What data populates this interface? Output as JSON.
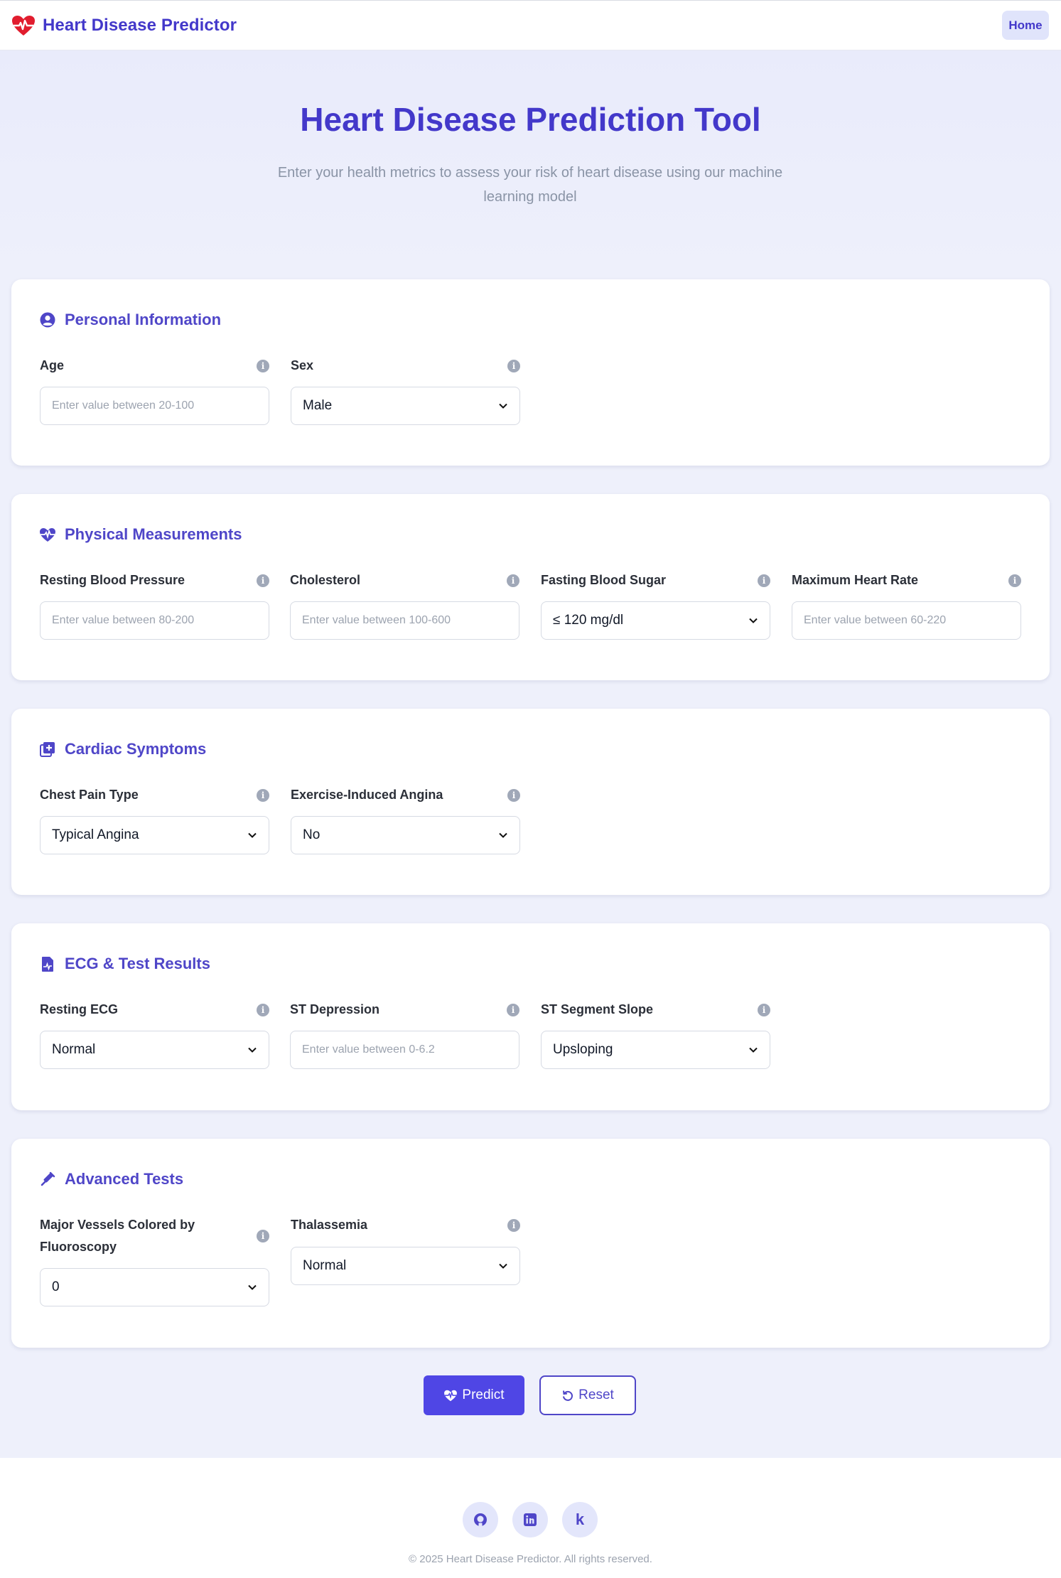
{
  "header": {
    "brand_title": "Heart Disease Predictor",
    "home_label": "Home"
  },
  "hero": {
    "title": "Heart Disease Prediction Tool",
    "subtitle": "Enter your health metrics to assess your risk of heart disease using our machine learning model"
  },
  "sections": {
    "personal": {
      "title": "Personal Information",
      "age": {
        "label": "Age",
        "placeholder": "Enter value between 20-100"
      },
      "sex": {
        "label": "Sex",
        "value": "Male"
      }
    },
    "physical": {
      "title": "Physical Measurements",
      "resting_bp": {
        "label": "Resting Blood Pressure",
        "placeholder": "Enter value between 80-200"
      },
      "cholesterol": {
        "label": "Cholesterol",
        "placeholder": "Enter value between 100-600"
      },
      "fasting_bs": {
        "label": "Fasting Blood Sugar",
        "value": "≤ 120 mg/dl"
      },
      "max_hr": {
        "label": "Maximum Heart Rate",
        "placeholder": "Enter value between 60-220"
      }
    },
    "cardiac": {
      "title": "Cardiac Symptoms",
      "chest_pain": {
        "label": "Chest Pain Type",
        "value": "Typical Angina"
      },
      "exercise_angina": {
        "label": "Exercise-Induced Angina",
        "value": "No"
      }
    },
    "ecg": {
      "title": "ECG & Test Results",
      "resting_ecg": {
        "label": "Resting ECG",
        "value": "Normal"
      },
      "st_depression": {
        "label": "ST Depression",
        "placeholder": "Enter value between 0-6.2"
      },
      "st_slope": {
        "label": "ST Segment Slope",
        "value": "Upsloping"
      }
    },
    "advanced": {
      "title": "Advanced Tests",
      "major_vessels": {
        "label": "Major Vessels Colored by Fluoroscopy",
        "value": "0"
      },
      "thalassemia": {
        "label": "Thalassemia",
        "value": "Normal"
      }
    }
  },
  "actions": {
    "predict_label": "Predict",
    "reset_label": "Reset"
  },
  "footer": {
    "kaggle_letter": "k",
    "copyright": "© 2025 Heart Disease Predictor. All rights reserved."
  },
  "colors": {
    "accent": "#4f46e5",
    "brand_text": "#4338ca",
    "heart_red": "#e11d2e",
    "background": "#eef0fb"
  },
  "icons": {
    "brand": "heart-pulse-icon",
    "personal": "user-circle-icon",
    "physical": "heart-pulse-icon",
    "cardiac": "medical-file-plus-icon",
    "ecg": "file-waveform-icon",
    "advanced": "syringe-icon",
    "info": "info-icon",
    "github": "github-icon",
    "linkedin": "linkedin-icon",
    "kaggle": "kaggle-icon"
  }
}
